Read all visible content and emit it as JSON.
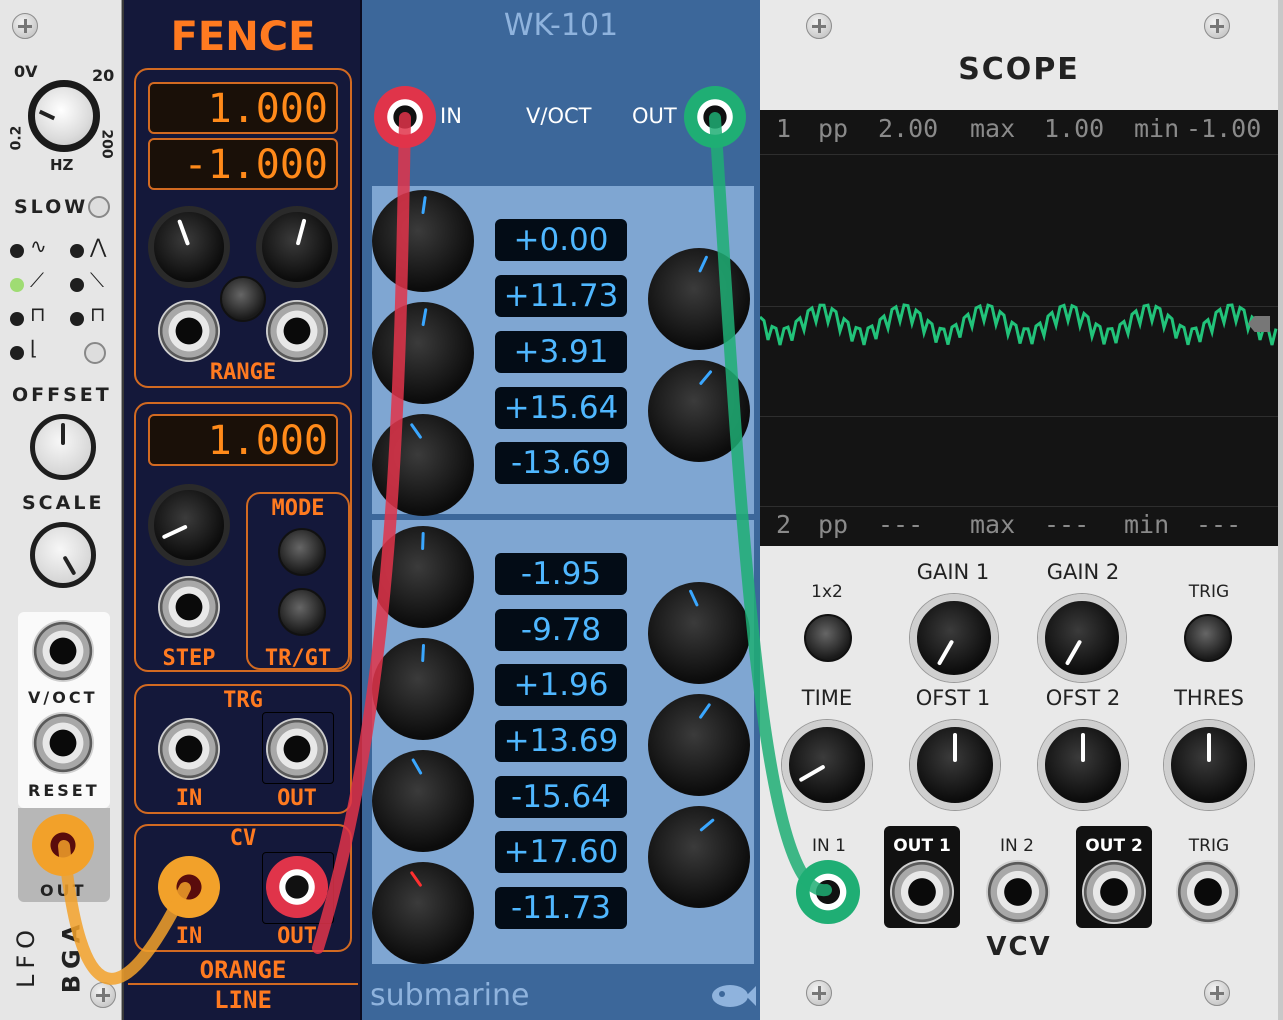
{
  "lfo": {
    "freq_left": "0V",
    "freq_right": "20",
    "freq_low": "0.2",
    "freq_high": "200",
    "freq_unit": "HZ",
    "slow": "SLOW",
    "offset": "OFFSET",
    "scale": "SCALE",
    "voct": "V/OCT",
    "reset": "RESET",
    "out": "OUT",
    "name": "LFO",
    "brand": "BGA"
  },
  "fence": {
    "title": "FENCE",
    "display_high": "1.000",
    "display_low": "-1.000",
    "range": "RANGE",
    "display_step": "1.000",
    "mode": "MODE",
    "step": "STEP",
    "trgt": "TR/GT",
    "trg": "TRG",
    "trg_in": "IN",
    "trg_out": "OUT",
    "cv": "CV",
    "cv_in": "IN",
    "cv_out": "OUT",
    "brand_line1": "ORANGE",
    "brand_line2": "LINE"
  },
  "wk": {
    "title": "WK-101",
    "in": "IN",
    "voct": "V/OCT",
    "out": "OUT",
    "values": [
      "+0.00",
      "+11.73",
      "+3.91",
      "+15.64",
      "-13.69",
      "-1.95",
      "-9.78",
      "+1.96",
      "+13.69",
      "-15.64",
      "+17.60",
      "-11.73"
    ],
    "brand": "submarine"
  },
  "scope": {
    "title": "SCOPE",
    "ch1": {
      "num": "1",
      "pp_label": "pp",
      "pp": "2.00",
      "max_label": "max",
      "max": "1.00",
      "min_label": "min",
      "min": "-1.00"
    },
    "ch2": {
      "num": "2",
      "pp_label": "pp",
      "pp": "---",
      "max_label": "max",
      "max": "---",
      "min_label": "min",
      "min": "---"
    },
    "x2": "1x2",
    "gain1": "GAIN 1",
    "gain2": "GAIN 2",
    "trig": "TRIG",
    "time": "TIME",
    "ofst1": "OFST 1",
    "ofst2": "OFST 2",
    "thres": "THRES",
    "in1": "IN 1",
    "out1": "OUT 1",
    "in2": "IN 2",
    "out2": "OUT 2",
    "trig_jack": "TRIG",
    "brand": "VCV",
    "trace_color": "#22c37a"
  },
  "cables": {
    "red": "#e0344a",
    "green": "#1fae74",
    "orange": "#f2a12a"
  }
}
